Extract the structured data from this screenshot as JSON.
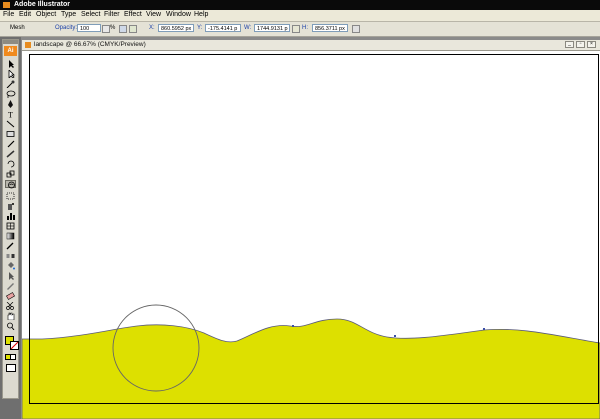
{
  "app": {
    "title": "Adobe Illustrator"
  },
  "menu": [
    "File",
    "Edit",
    "Object",
    "Type",
    "Select",
    "Filter",
    "Effect",
    "View",
    "Window",
    "Help"
  ],
  "control": {
    "mode_label": "Mesh",
    "opacity_label": "Opacity:",
    "opacity_value": "100",
    "opacity_unit": "%",
    "x_label": "X:",
    "x_value": "860.5952 px",
    "y_label": "Y:",
    "y_value": "-175.4141 p",
    "w_label": "W:",
    "w_value": "1744.9131 p",
    "h_label": "H:",
    "h_value": "856.3711 px"
  },
  "document": {
    "tab_title": "landscape @ 66.67% (CMYK/Preview)"
  },
  "toolbox": {
    "logo": "Ai",
    "tools": [
      "selection",
      "direct-selection",
      "magic-wand",
      "lasso",
      "pen",
      "type",
      "line",
      "rectangle",
      "paintbrush",
      "pencil",
      "rotate",
      "scale",
      "warp",
      "free-transform",
      "symbol-sprayer",
      "column-graph",
      "mesh",
      "gradient",
      "eyedropper",
      "blend",
      "live-paint-bucket",
      "live-paint-selection",
      "slice",
      "eraser",
      "scissors",
      "hand",
      "zoom"
    ]
  },
  "colors": {
    "ground_fill": "#dde000",
    "mesh_stroke": "#5a5a7a",
    "fill_swatch": "#dde000"
  }
}
